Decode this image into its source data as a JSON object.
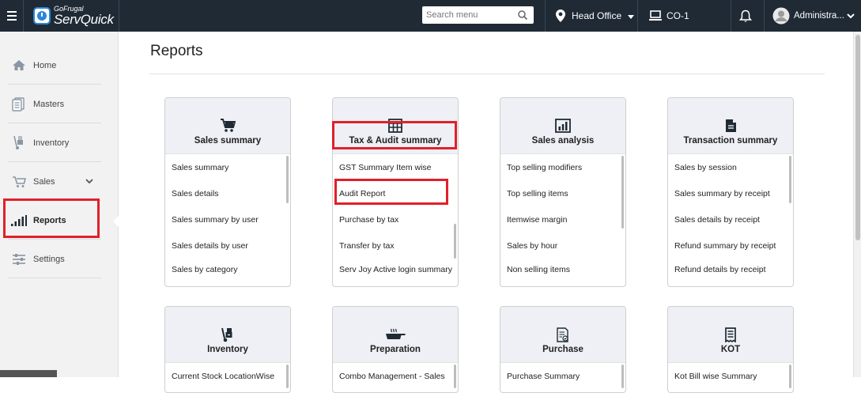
{
  "topbar": {
    "brand_sub": "GoFrugal",
    "brand_main": "ServQuick",
    "search_placeholder": "Search menu",
    "location": "Head Office",
    "company": "CO-1",
    "user": "Administra..."
  },
  "sidebar": {
    "items": [
      {
        "label": "Home",
        "icon": "home-icon"
      },
      {
        "label": "Masters",
        "icon": "masters-icon"
      },
      {
        "label": "Inventory",
        "icon": "inventory-icon"
      },
      {
        "label": "Sales",
        "icon": "sales-icon"
      },
      {
        "label": "Reports",
        "icon": "reports-icon"
      },
      {
        "label": "Settings",
        "icon": "settings-icon"
      }
    ]
  },
  "page": {
    "title": "Reports"
  },
  "cards": [
    {
      "title": "Sales summary",
      "icon": "cart-icon",
      "items": [
        "Sales summary",
        "Sales details",
        "Sales summary by user",
        "Sales details by user",
        "Sales by category"
      ]
    },
    {
      "title": "Tax & Audit summary",
      "icon": "tax-calculator-icon",
      "items": [
        "GST Summary Item wise",
        "Audit Report",
        "Purchase by tax",
        "Transfer by tax",
        "Serv Joy Active login summary"
      ]
    },
    {
      "title": "Sales analysis",
      "icon": "bar-chart-icon",
      "items": [
        "Top selling modifiers",
        "Top selling items",
        "Itemwise margin",
        "Sales by hour",
        "Non selling items"
      ]
    },
    {
      "title": "Transaction summary",
      "icon": "document-icon",
      "items": [
        "Sales by session",
        "Sales summary by receipt",
        "Sales details by receipt",
        "Refund summary by receipt",
        "Refund details by receipt"
      ]
    },
    {
      "title": "Inventory",
      "icon": "hand-truck-icon",
      "items": [
        "Current Stock LocationWise"
      ]
    },
    {
      "title": "Preparation",
      "icon": "cooking-pan-icon",
      "items": [
        "Combo Management - Sales"
      ]
    },
    {
      "title": "Purchase",
      "icon": "purchase-receipt-icon",
      "items": [
        "Purchase Summary"
      ]
    },
    {
      "title": "KOT",
      "icon": "kot-receipt-icon",
      "items": [
        "Kot Bill wise Summary"
      ]
    }
  ]
}
